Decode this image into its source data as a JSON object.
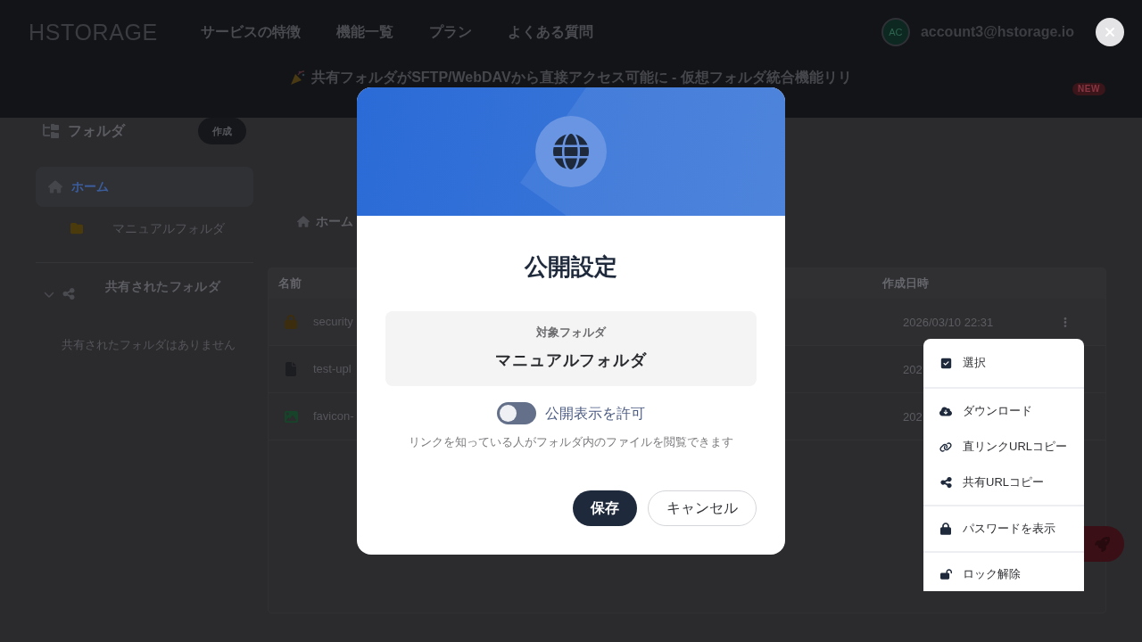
{
  "header": {
    "logo": "HSTORAGE",
    "nav": [
      {
        "label": "サービスの特徴"
      },
      {
        "label": "機能一覧"
      },
      {
        "label": "プラン"
      },
      {
        "label": "よくある質問"
      }
    ],
    "user": {
      "initials": "AC",
      "email": "account3@hstorage.io"
    },
    "announcement": {
      "text": "共有フォルダがSFTP/WebDAVから直接アクセス可能に - 仮想フォルダ統合機能リリ",
      "badge": "NEW"
    }
  },
  "sidebar": {
    "title": "フォルダ",
    "create_button": "作成",
    "items": [
      {
        "kind": "home",
        "label": "ホーム",
        "selected": true
      },
      {
        "kind": "folder",
        "label": "マニュアルフォルダ",
        "selected": false
      }
    ],
    "shared": {
      "title": "共有されたフォルダ",
      "expanded": true,
      "empty_text": "共有されたフォルダはありません"
    }
  },
  "breadcrumb": [
    {
      "label": "ホーム"
    }
  ],
  "table": {
    "columns": [
      {
        "label": "名前"
      },
      {
        "label": "作成日時"
      }
    ],
    "rows": [
      {
        "kind": "locked",
        "name": "security",
        "created": "2026/03/10 22:31",
        "menu_open": true
      },
      {
        "kind": "document",
        "name": "test-upl",
        "created": "202",
        "menu_open": false
      },
      {
        "kind": "image",
        "name": "favicon-",
        "created": "202",
        "menu_open": false
      }
    ]
  },
  "dialog": {
    "title": "公開設定",
    "target_label": "対象フォルダ",
    "target_name": "マニュアルフォルダ",
    "toggle": {
      "label": "公開表示を許可",
      "on": false
    },
    "description": "リンクを知っている人がフォルダ内のファイルを閲覧できます",
    "buttons": [
      {
        "kind": "primary",
        "label": "保存"
      },
      {
        "kind": "secondary",
        "label": "キャンセル"
      }
    ]
  },
  "context_menu": {
    "groups": [
      {
        "items": [
          {
            "label": "選択"
          }
        ]
      },
      {
        "items": [
          {
            "label": "ダウンロード"
          },
          {
            "label": "直リンクURLコピー"
          },
          {
            "label": "共有URLコピー"
          }
        ]
      },
      {
        "items": [
          {
            "label": "パスワードを表示"
          }
        ]
      },
      {
        "items": [
          {
            "label": "ロック解除"
          }
        ]
      }
    ]
  }
}
